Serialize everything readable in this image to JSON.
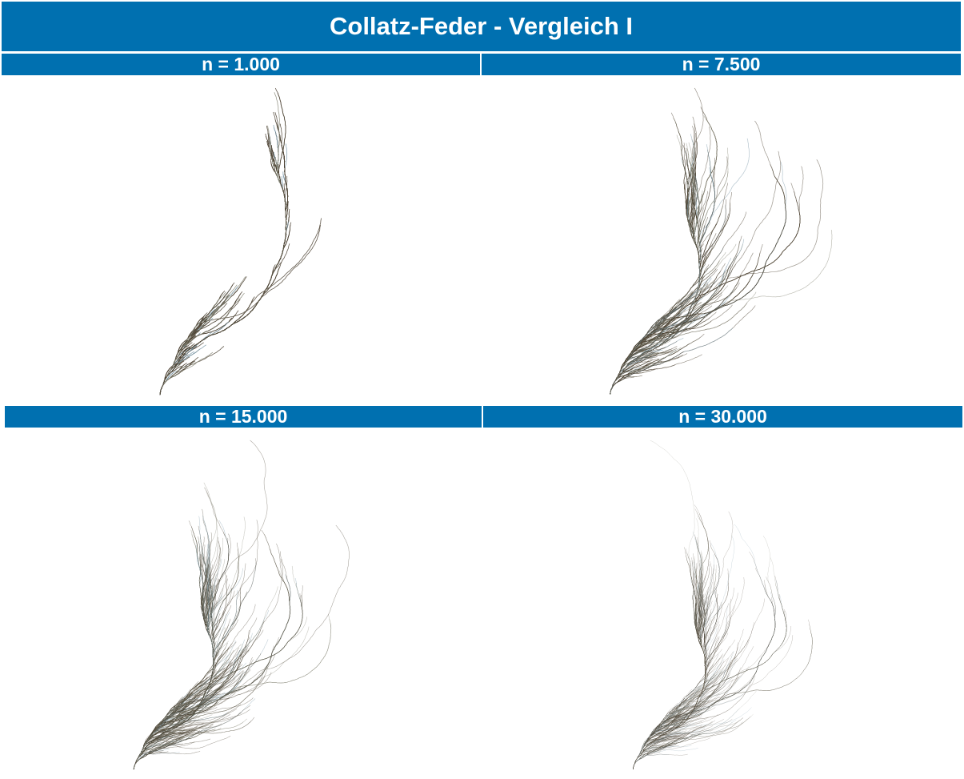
{
  "title": "Collatz-Feder - Vergleich I",
  "panels": [
    {
      "label": "n = 1.000",
      "n": 1000
    },
    {
      "label": "n = 7.500",
      "n": 7500
    },
    {
      "label": "n = 15.000",
      "n": 15000
    },
    {
      "label": "n = 30.000",
      "n": 30000
    }
  ],
  "colors": {
    "banner": "#0070b0",
    "banner_text": "#ffffff",
    "stroke_dark": "#4a4030",
    "stroke_light": "#8a8a7a",
    "stroke_blue": "#7a98a8"
  }
}
